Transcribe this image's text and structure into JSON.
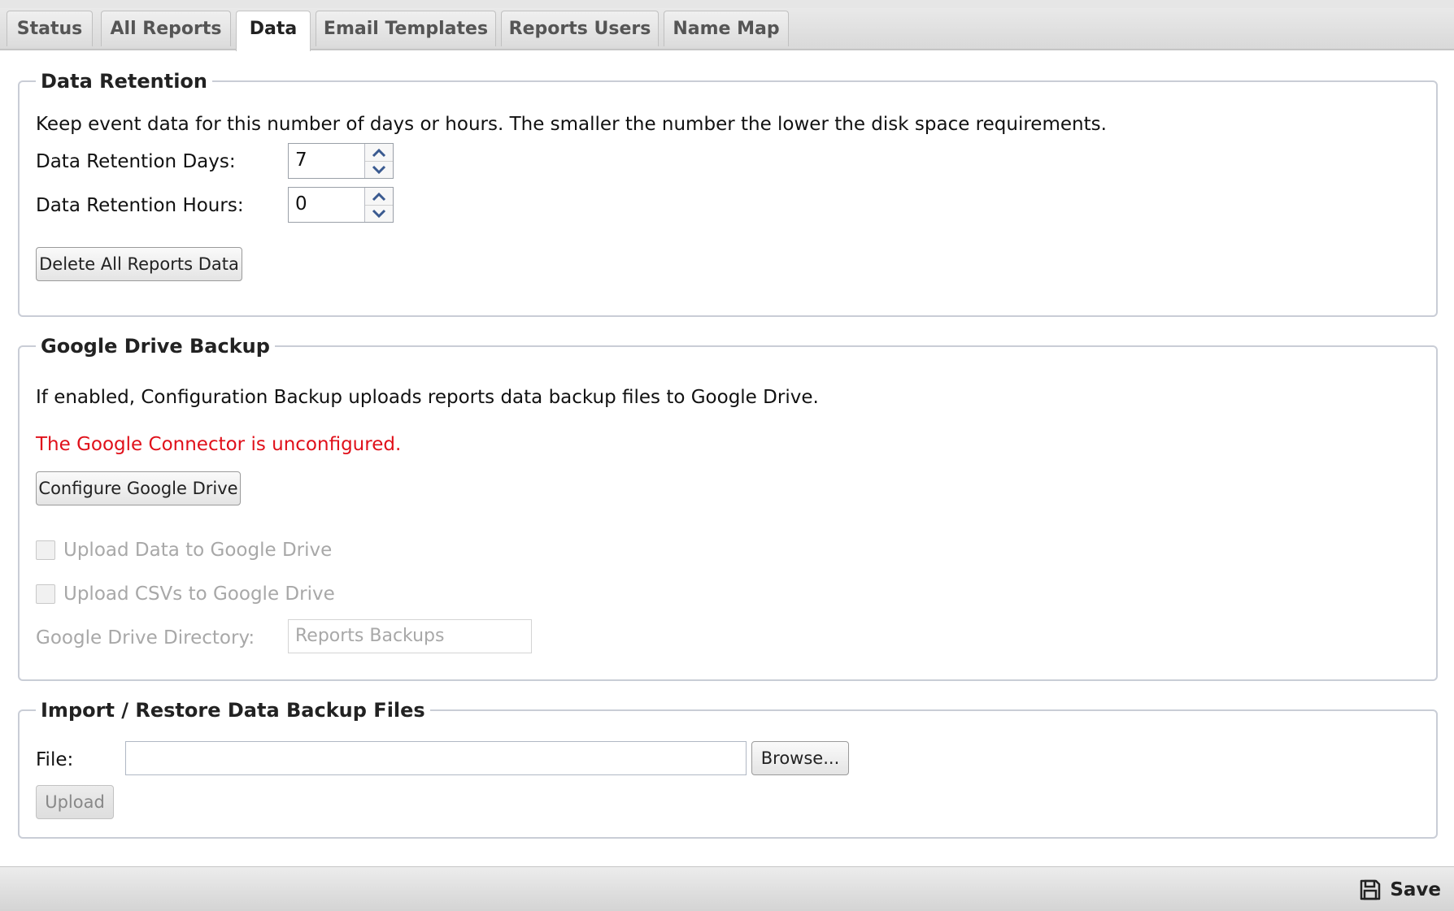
{
  "tabs": [
    {
      "label": "Status"
    },
    {
      "label": "All Reports"
    },
    {
      "label": "Data",
      "active": true
    },
    {
      "label": "Email Templates"
    },
    {
      "label": "Reports Users"
    },
    {
      "label": "Name Map"
    }
  ],
  "data_retention": {
    "legend": "Data Retention",
    "description": "Keep event data for this number of days or hours. The smaller the number the lower the disk space requirements.",
    "days_label": "Data Retention Days:",
    "days_value": "7",
    "hours_label": "Data Retention Hours:",
    "hours_value": "0",
    "delete_button": "Delete All Reports Data"
  },
  "google_drive": {
    "legend": "Google Drive Backup",
    "description": "If enabled, Configuration Backup uploads reports data backup files to Google Drive.",
    "error": "The Google Connector is unconfigured.",
    "configure_button": "Configure Google Drive",
    "upload_data_label": "Upload Data to Google Drive",
    "upload_data_checked": false,
    "upload_csvs_label": "Upload CSVs to Google Drive",
    "upload_csvs_checked": false,
    "directory_label": "Google Drive Directory:",
    "directory_value": "Reports Backups"
  },
  "import_restore": {
    "legend": "Import / Restore Data Backup Files",
    "file_label": "File:",
    "file_value": "",
    "browse_button": "Browse...",
    "upload_button": "Upload"
  },
  "footer": {
    "save_label": "Save"
  },
  "colors": {
    "error": "#e0101a",
    "disabled_text": "#a8a8a8"
  }
}
